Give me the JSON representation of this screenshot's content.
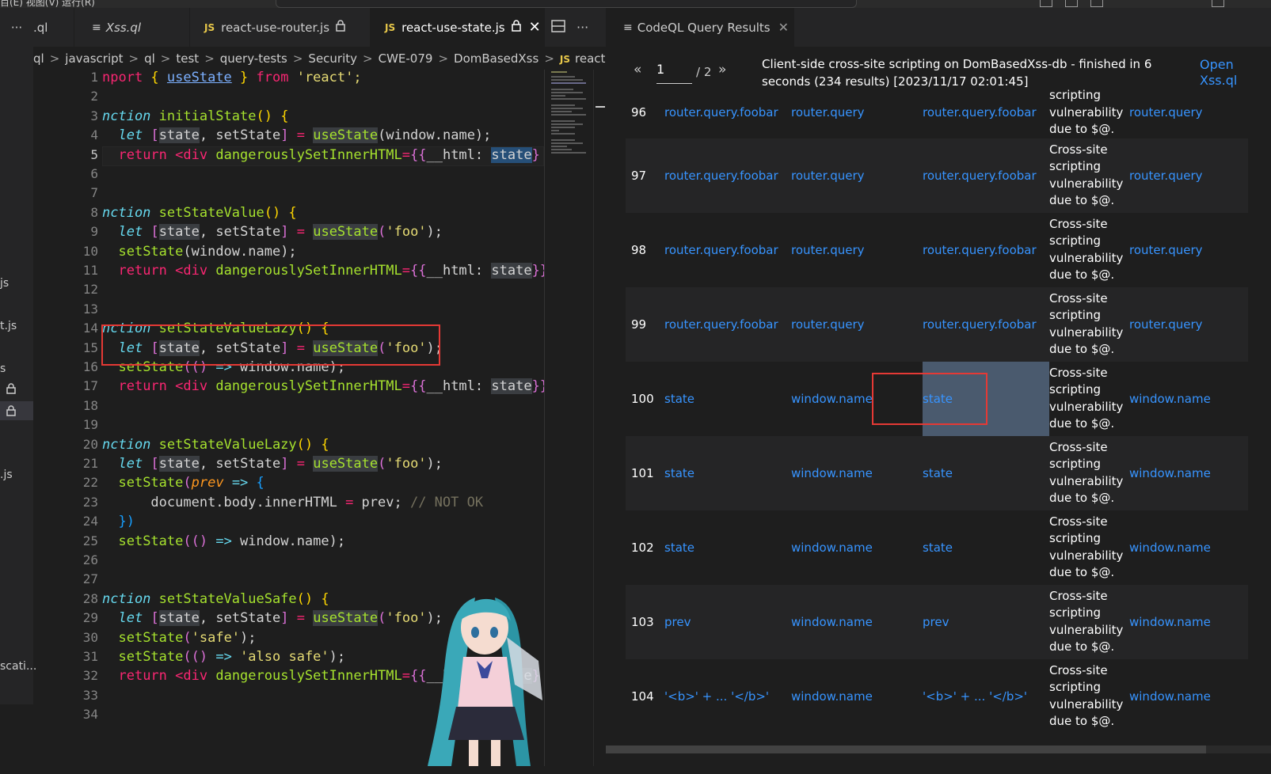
{
  "window": {
    "menu_text": "百(E)    视图(V)    运行(R)"
  },
  "sidebar": {
    "items": [
      {
        "label": "js"
      },
      {
        "label": "t.js"
      },
      {
        "label": "s"
      },
      {
        "label": ".js"
      },
      {
        "label": "scati..."
      }
    ]
  },
  "editor_tabs": [
    {
      "label": ".ql",
      "type": "ql"
    },
    {
      "label": "Xss.ql",
      "type": "ql"
    },
    {
      "label": "react-use-router.js",
      "type": "js",
      "locked": true
    },
    {
      "label": "react-use-state.js",
      "type": "js",
      "locked": true,
      "active": true
    }
  ],
  "icons": {
    "more": "more-icon",
    "lock": "lock-icon",
    "close": "close-icon",
    "split": "split-editor-icon",
    "js": "js-file-icon",
    "lines": "query-file-icon"
  },
  "breadcrumb": [
    "ql",
    "javascript",
    "ql",
    "test",
    "query-tests",
    "Security",
    "CWE-079",
    "DomBasedXss",
    "react-use-state.js"
  ],
  "line_numbers": [
    "1",
    "2",
    "3",
    "4",
    "5",
    "6",
    "7",
    "8",
    "9",
    "10",
    "11",
    "12",
    "13",
    "14",
    "15",
    "16",
    "17",
    "18",
    "19",
    "20",
    "21",
    "22",
    "23",
    "24",
    "25",
    "26",
    "27",
    "28",
    "29",
    "30",
    "31",
    "32",
    "33",
    "34"
  ],
  "results_tab": {
    "label": "CodeQL Query Results"
  },
  "results": {
    "page_current": "1",
    "page_total": "/ 2",
    "prev_label": "«",
    "next_label": "»",
    "title": "Client-side cross-site scripting on DomBasedXss-db - finished in 6 seconds (234 results) [2023/11/17 02:01:45]",
    "open_link": "Open Xss.ql",
    "rows": [
      {
        "n": "96",
        "c1": "router.query.foobar",
        "c2": "router.query",
        "c3": "router.query.foobar",
        "msg": "scripting vulnerability due to $@.",
        "c4": "router.query"
      },
      {
        "n": "97",
        "c1": "router.query.foobar",
        "c2": "router.query",
        "c3": "router.query.foobar",
        "msg": "Cross-site scripting vulnerability due to $@.",
        "c4": "router.query"
      },
      {
        "n": "98",
        "c1": "router.query.foobar",
        "c2": "router.query",
        "c3": "router.query.foobar",
        "msg": "Cross-site scripting vulnerability due to $@.",
        "c4": "router.query"
      },
      {
        "n": "99",
        "c1": "router.query.foobar",
        "c2": "router.query",
        "c3": "router.query.foobar",
        "msg": "Cross-site scripting vulnerability due to $@.",
        "c4": "router.query"
      },
      {
        "n": "100",
        "c1": "state",
        "c2": "window.name",
        "c3": "state",
        "msg": "Cross-site scripting vulnerability due to $@.",
        "c4": "window.name"
      },
      {
        "n": "101",
        "c1": "state",
        "c2": "window.name",
        "c3": "state",
        "msg": "Cross-site scripting vulnerability due to $@.",
        "c4": "window.name"
      },
      {
        "n": "102",
        "c1": "state",
        "c2": "window.name",
        "c3": "state",
        "msg": "Cross-site scripting vulnerability due to $@.",
        "c4": "window.name"
      },
      {
        "n": "103",
        "c1": "prev",
        "c2": "window.name",
        "c3": "prev",
        "msg": "Cross-site scripting vulnerability due to $@.",
        "c4": "window.name"
      },
      {
        "n": "104",
        "c1": "'<b>' + ... '</b>'",
        "c2": "window.name",
        "c3": "'<b>' + ... '</b>'",
        "msg": "Cross-site scripting vulnerability due to $@.",
        "c4": "window.name"
      }
    ]
  },
  "code": {
    "l1": {
      "a": "nport ",
      "b": "{ ",
      "c": "useState",
      "d": " } ",
      "e": "from",
      "f": " 'react';"
    },
    "l3": {
      "a": "nction ",
      "b": "initialState",
      "c": "() {"
    },
    "l4": {
      "a": "let ",
      "b": "[",
      "c": "state",
      "d": ", ",
      "e": "setState",
      "f": "]",
      "g": " = ",
      "h": "useState",
      "i": "(window.name);"
    },
    "l5": {
      "a": "return ",
      "b": "<",
      "c": "div ",
      "d": "dangerouslySetInnerHTML",
      "e": "=",
      "f": "{{",
      "g": "__html: ",
      "h": "state",
      "i": "}"
    },
    "l8": {
      "a": "nction ",
      "b": "setStateValue",
      "c": "() {"
    },
    "l9": {
      "a": "let ",
      "b": "[",
      "c": "state",
      "d": ", ",
      "e": "setState",
      "f": "]",
      "g": " = ",
      "h": "useState",
      "i": "(",
      "j": "'foo'",
      "k": ");"
    },
    "l10": {
      "a": "setState",
      "b": "(window.name);"
    },
    "l11": {
      "a": "return ",
      "b": "<",
      "c": "div ",
      "d": "dangerouslySetInnerHTML",
      "e": "=",
      "f": "{{",
      "g": "__html: ",
      "h": "state",
      "i": "}}"
    },
    "l14": {
      "a": "nction ",
      "b": "setStateValueLazy",
      "c": "() {"
    },
    "l15": {
      "a": "let ",
      "b": "[",
      "c": "state",
      "d": ", ",
      "e": "setState",
      "f": "]",
      "g": " = ",
      "h": "useState",
      "i": "(",
      "j": "'foo'",
      "k": ");"
    },
    "l16": {
      "a": "setState",
      "b": "(() ",
      "c": "=>",
      "d": " window.name);"
    },
    "l17": {
      "a": "return ",
      "b": "<",
      "c": "div ",
      "d": "dangerouslySetInnerHTML",
      "e": "=",
      "f": "{{",
      "g": "__html: ",
      "h": "state",
      "i": "}}"
    },
    "l20": {
      "a": "nction ",
      "b": "setStateValueLazy",
      "c": "() {"
    },
    "l21": {
      "a": "let ",
      "b": "[",
      "c": "state",
      "d": ", ",
      "e": "setState",
      "f": "]",
      "g": " = ",
      "h": "useState",
      "i": "(",
      "j": "'foo'",
      "k": ");"
    },
    "l22": {
      "a": "setState",
      "b": "(",
      "c": "prev",
      "d": " => ",
      "e": "{"
    },
    "l23": {
      "a": "document.body.innerHTML ",
      "b": "=",
      "c": " prev; ",
      "d": "// NOT OK"
    },
    "l24": {
      "a": "})"
    },
    "l25": {
      "a": "setState",
      "b": "(() ",
      "c": "=>",
      "d": " window.name);"
    },
    "l28": {
      "a": "nction ",
      "b": "setStateValueSafe",
      "c": "() {"
    },
    "l29": {
      "a": "let ",
      "b": "[",
      "c": "state",
      "d": ", ",
      "e": "setState",
      "f": "]",
      "g": " = ",
      "h": "useState",
      "i": "(",
      "j": "'foo'",
      "k": ");"
    },
    "l30": {
      "a": "setState",
      "b": "(",
      "c": "'safe'",
      "d": ");"
    },
    "l31": {
      "a": "setState",
      "b": "(() ",
      "c": "=>",
      "d": " ",
      "e": "'also safe'",
      "f": ");"
    },
    "l32": {
      "a": "return ",
      "b": "<",
      "c": "div ",
      "d": "dangerouslySetInnerHTML",
      "e": "=",
      "f": "{{",
      "g": "__html: ",
      "h": "state",
      "i": "}"
    }
  }
}
